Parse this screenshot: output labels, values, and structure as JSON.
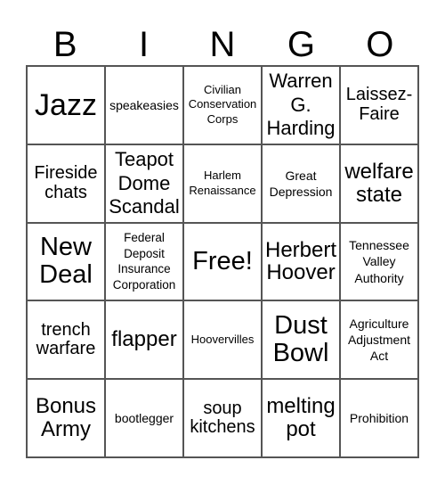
{
  "header": {
    "letters": [
      "B",
      "I",
      "N",
      "G",
      "O"
    ]
  },
  "rows": [
    [
      "Jazz",
      "speakeasies",
      "Civilian Conservation Corps",
      "Warren G. Harding",
      "Laissez-Faire"
    ],
    [
      "Fireside chats",
      "Teapot Dome Scandal",
      "Harlem Renaissance",
      "Great Depression",
      "welfare state"
    ],
    [
      "New Deal",
      "Federal Deposit Insurance Corporation",
      "Free!",
      "Herbert Hoover",
      "Tennessee Valley Authority"
    ],
    [
      "trench warfare",
      "flapper",
      "Hoovervilles",
      "Dust Bowl",
      "Agriculture Adjustment Act"
    ],
    [
      "Bonus Army",
      "bootlegger",
      "soup kitchens",
      "melting pot",
      "Prohibition"
    ]
  ]
}
